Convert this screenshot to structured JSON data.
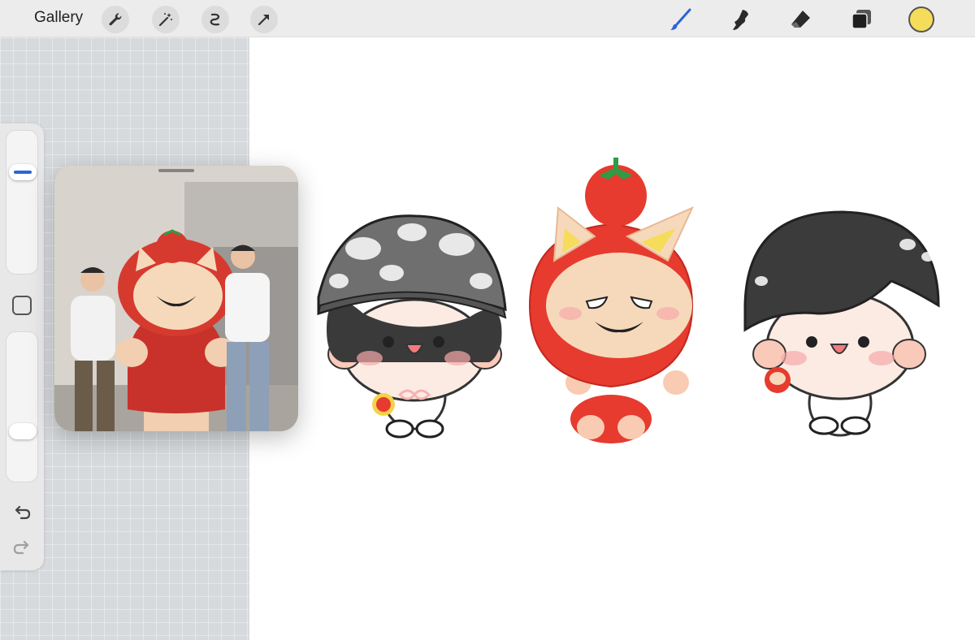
{
  "topbar": {
    "gallery_label": "Gallery",
    "left_tools": [
      "wrench-icon",
      "magic-wand-icon",
      "selection-icon",
      "transform-arrow-icon"
    ],
    "right_tools": [
      "brush-icon",
      "smudge-icon",
      "eraser-icon",
      "layers-icon"
    ],
    "current_color": "#f5dc5a"
  },
  "sidebar": {
    "size_slider_level": 0.25,
    "opacity_slider_level": 0.68
  },
  "colors": {
    "accent_blue": "#2c64d8",
    "tomato_red": "#e63b2e",
    "skin": "#fbe3d6",
    "cat_face": "#f6d9bb"
  }
}
